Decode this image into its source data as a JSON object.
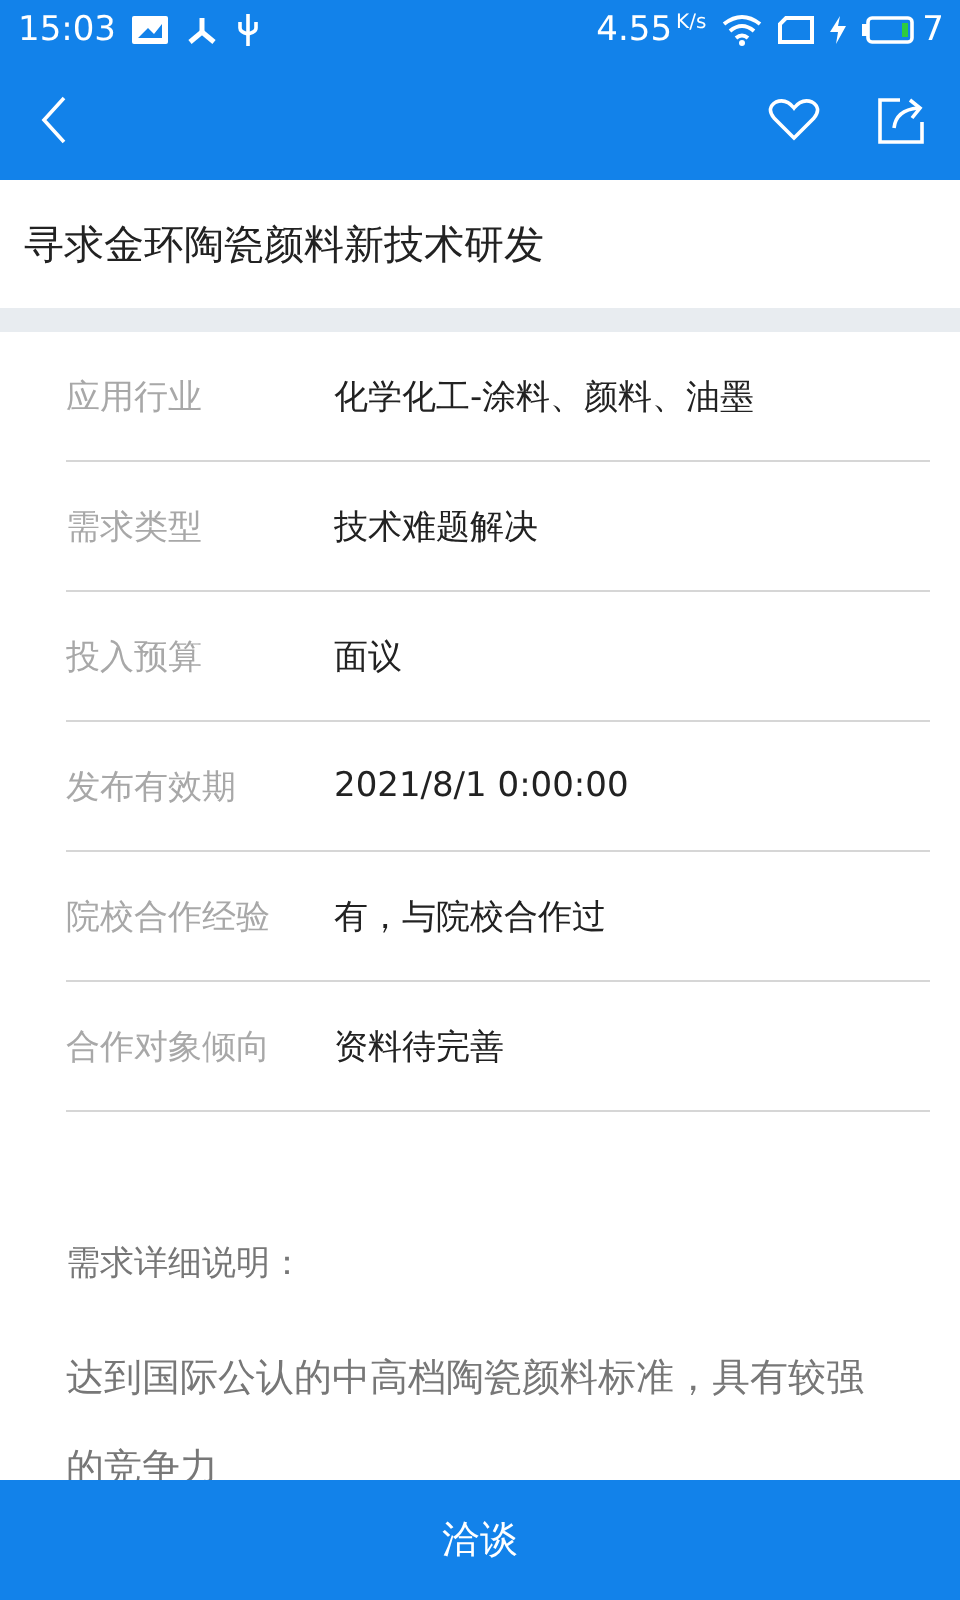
{
  "status_bar": {
    "time": "15:03",
    "speed": "4.55",
    "speed_unit": "K/s",
    "battery": "7"
  },
  "title": "寻求金环陶瓷颜料新技术研发",
  "fields": [
    {
      "label": "应用行业",
      "value": "化学化工-涂料、颜料、油墨"
    },
    {
      "label": "需求类型",
      "value": "技术难题解决"
    },
    {
      "label": "投入预算",
      "value": "面议"
    },
    {
      "label": "发布有效期",
      "value": "2021/8/1 0:00:00"
    },
    {
      "label": "院校合作经验",
      "value": "有，与院校合作过"
    },
    {
      "label": "合作对象倾向",
      "value": "资料待完善"
    }
  ],
  "description": {
    "heading": "需求详细说明：",
    "text": "达到国际公认的中高档陶瓷颜料标准，具有较强的竞争力"
  },
  "action_button": "洽谈"
}
